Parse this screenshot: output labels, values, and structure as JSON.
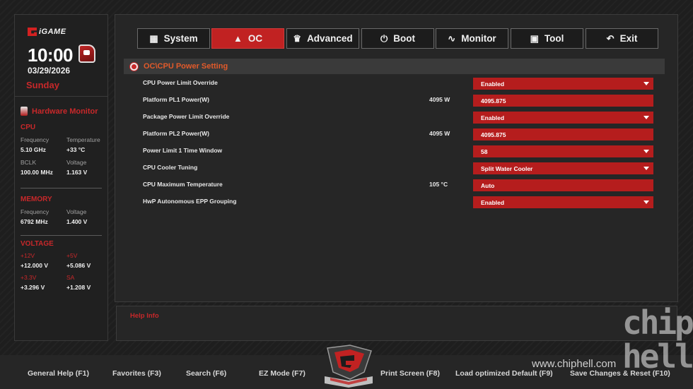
{
  "brand": {
    "logo_text": "iGAME"
  },
  "clock": {
    "time": "10:00",
    "date": "03/29/2026",
    "day": "Sunday"
  },
  "hardware_monitor": {
    "title": "Hardware Monitor",
    "cpu": {
      "label": "CPU",
      "frequency_label": "Frequency",
      "frequency": "5.10 GHz",
      "temperature_label": "Temperature",
      "temperature": "+33 °C",
      "bclk_label": "BCLK",
      "bclk": "100.00 MHz",
      "voltage_label": "Voltage",
      "voltage": "1.163 V"
    },
    "memory": {
      "label": "MEMORY",
      "frequency_label": "Frequency",
      "frequency": "6792 MHz",
      "voltage_label": "Voltage",
      "voltage": "1.400 V"
    },
    "voltage": {
      "label": "VOLTAGE",
      "v12_label": "+12V",
      "v12": "+12.000 V",
      "v5_label": "+5V",
      "v5": "+5.086 V",
      "v33_label": "+3.3V",
      "v33": "+3.296 V",
      "sa_label": "SA",
      "sa": "+1.208 V"
    }
  },
  "tabs": [
    {
      "label": "System",
      "active": false
    },
    {
      "label": "OC",
      "active": true
    },
    {
      "label": "Advanced",
      "active": false
    },
    {
      "label": "Boot",
      "active": false
    },
    {
      "label": "Monitor",
      "active": false
    },
    {
      "label": "Tool",
      "active": false
    },
    {
      "label": "Exit",
      "active": false
    }
  ],
  "breadcrumb": "OC\\CPU Power Setting",
  "settings": [
    {
      "label": "CPU Power Limit Override",
      "unit": "",
      "value": "Enabled",
      "dropdown": true
    },
    {
      "label": "Platform PL1 Power(W)",
      "unit": "4095 W",
      "value": "4095.875",
      "dropdown": false
    },
    {
      "label": "Package Power Limit Override",
      "unit": "",
      "value": "Enabled",
      "dropdown": true
    },
    {
      "label": "Platform PL2 Power(W)",
      "unit": "4095 W",
      "value": "4095.875",
      "dropdown": false
    },
    {
      "label": "Power Limit 1 Time Window",
      "unit": "",
      "value": "58",
      "dropdown": true
    },
    {
      "label": "CPU Cooler Tuning",
      "unit": "",
      "value": "Split Water Cooler",
      "dropdown": true
    },
    {
      "label": "CPU Maximum Temperature",
      "unit": "105 °C",
      "value": "Auto",
      "dropdown": false
    },
    {
      "label": "HwP Autonomous EPP Grouping",
      "unit": "",
      "value": "Enabled",
      "dropdown": true
    }
  ],
  "help": {
    "label": "Help Info"
  },
  "footer": {
    "general_help": "General Help (F1)",
    "favorites": "Favorites (F3)",
    "search": "Search (F6)",
    "ez_mode": "EZ Mode (F7)",
    "print_screen": "Print Screen (F8)",
    "load_default": "Load optimized Default (F9)",
    "save_reset": "Save Changes & Reset (F10)"
  },
  "watermark": {
    "url": "www.chiphell.com",
    "logo_text": "chip hell"
  },
  "colors": {
    "accent": "#c12222",
    "panel": "#262626",
    "background": "#1e1e1e",
    "breadcrumb_text": "#e25a2a"
  }
}
